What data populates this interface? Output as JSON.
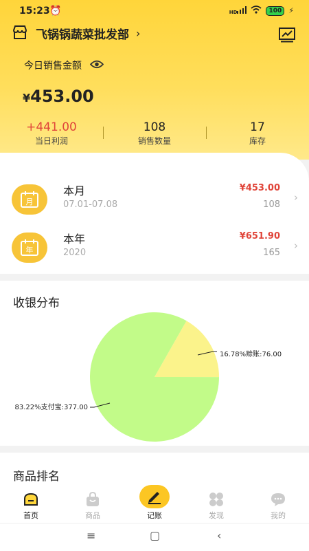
{
  "status": {
    "time": "15:23",
    "battery": "100",
    "network": "HD"
  },
  "store": {
    "name": "飞锅锅蔬菜批发部",
    "chevron": "›"
  },
  "sales": {
    "label": "今日销售金额",
    "currency": "¥",
    "amount": "453.00"
  },
  "stats": [
    {
      "value": "+441.00",
      "label": "当日利润",
      "color": "#e0453a"
    },
    {
      "value": "108",
      "label": "销售数量",
      "color": "#222222"
    },
    {
      "value": "17",
      "label": "库存",
      "color": "#222222"
    }
  ],
  "periods": [
    {
      "icon_text": "月",
      "title": "本月",
      "range": "07.01-07.08",
      "amount": "¥453.00",
      "count": "108"
    },
    {
      "icon_text": "年",
      "title": "本年",
      "range": "2020",
      "amount": "¥651.90",
      "count": "165"
    }
  ],
  "distribution": {
    "title": "收银分布",
    "chart_data": {
      "type": "pie",
      "labels": [
        "赊账",
        "支付宝"
      ],
      "values": [
        76.0,
        377.0
      ],
      "percents": [
        16.78,
        83.22
      ],
      "colors": [
        "#fbf38b",
        "#c2fb89"
      ],
      "annotations": [
        "16.78%赊账:76.00",
        "83.22%支付宝:377.00"
      ]
    }
  },
  "ranking": {
    "title": "商品排名"
  },
  "tabs": [
    {
      "label": "首页",
      "icon": "home-icon"
    },
    {
      "label": "商品",
      "icon": "shopping-bag-icon"
    },
    {
      "label": "记账",
      "icon": "pen-icon"
    },
    {
      "label": "发现",
      "icon": "discover-grid-icon"
    },
    {
      "label": "我的",
      "icon": "chat-bubble-icon"
    }
  ],
  "nav": {
    "menu": "≡",
    "home": "▢",
    "back": "‹"
  }
}
